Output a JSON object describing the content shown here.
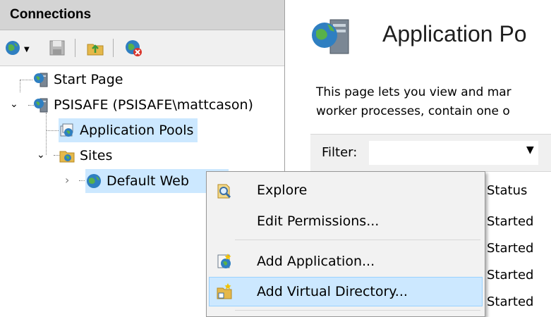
{
  "connections": {
    "title": "Connections",
    "toolbar": [
      {
        "name": "connect-icon"
      },
      {
        "name": "save-icon"
      },
      {
        "name": "up-folder-icon"
      },
      {
        "name": "disconnect-icon"
      }
    ],
    "tree": [
      {
        "label": "Start Page",
        "icon": "start-page-icon"
      },
      {
        "label": "PSISAFE (PSISAFE\\mattcason)",
        "icon": "server-icon",
        "expanded": true
      },
      {
        "label": "Application Pools",
        "icon": "app-pools-icon",
        "selected": true
      },
      {
        "label": "Sites",
        "icon": "sites-folder-icon",
        "expanded": true
      },
      {
        "label": "Default Web",
        "icon": "globe-icon",
        "selected": true
      }
    ]
  },
  "main": {
    "title": "Application Po",
    "description_lines": [
      "This page lets you view and mar",
      "worker processes, contain one o"
    ],
    "filter_label": "Filter:",
    "status_header": "Status",
    "status_values": [
      "Started",
      "Started",
      "Started",
      "Started"
    ]
  },
  "context_menu": {
    "items": [
      {
        "label": "Explore",
        "icon": "explore-icon"
      },
      {
        "label": "Edit Permissions...",
        "icon": ""
      },
      {
        "label": "Add Application...",
        "icon": "add-application-icon"
      },
      {
        "label": "Add Virtual Directory...",
        "icon": "add-virtual-directory-icon",
        "highlighted": true
      }
    ]
  },
  "colors": {
    "selection": "#cce8ff",
    "header_bg": "#d4d4d4",
    "toolbar_bg": "#f0f0f0",
    "menu_bg": "#f2f2f2"
  }
}
